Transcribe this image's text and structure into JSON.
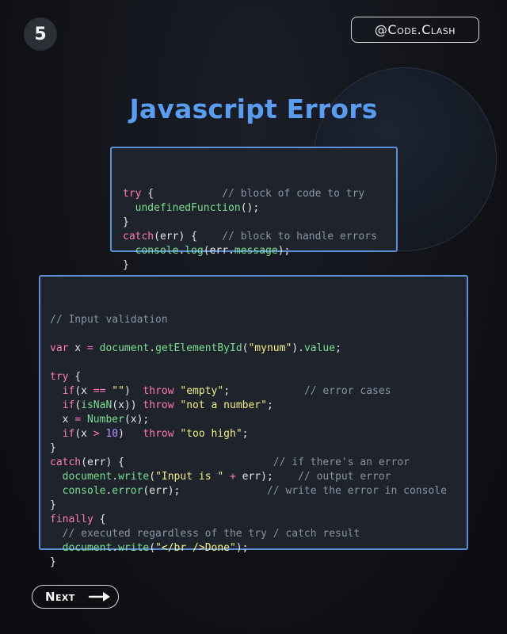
{
  "page_number": "5",
  "handle": "@Code.Clash",
  "title": "Javascript Errors",
  "snippet1": [
    [
      {
        "t": "try",
        "c": "kw"
      },
      {
        "t": " {           ",
        "c": "pl"
      },
      {
        "t": "// block of code to try",
        "c": "cm"
      }
    ],
    [
      {
        "t": "  ",
        "c": "pl"
      },
      {
        "t": "undefinedFunction",
        "c": "fn"
      },
      {
        "t": "();",
        "c": "pl"
      }
    ],
    [
      {
        "t": "}",
        "c": "pl"
      }
    ],
    [
      {
        "t": "catch",
        "c": "kw"
      },
      {
        "t": "(err) {    ",
        "c": "pl"
      },
      {
        "t": "// block to handle errors",
        "c": "cm"
      }
    ],
    [
      {
        "t": "  console",
        "c": "fn"
      },
      {
        "t": ".",
        "c": "pl"
      },
      {
        "t": "log",
        "c": "fn"
      },
      {
        "t": "(err.",
        "c": "pl"
      },
      {
        "t": "message",
        "c": "fn"
      },
      {
        "t": ");",
        "c": "pl"
      }
    ],
    [
      {
        "t": "}",
        "c": "pl"
      }
    ]
  ],
  "snippet2": [
    [
      {
        "t": "// Input validation",
        "c": "cm"
      }
    ],
    [],
    [
      {
        "t": "var",
        "c": "kw"
      },
      {
        "t": " x ",
        "c": "pl"
      },
      {
        "t": "=",
        "c": "op"
      },
      {
        "t": " ",
        "c": "pl"
      },
      {
        "t": "document",
        "c": "fn"
      },
      {
        "t": ".",
        "c": "pl"
      },
      {
        "t": "getElementById",
        "c": "fn"
      },
      {
        "t": "(",
        "c": "pl"
      },
      {
        "t": "\"mynum\"",
        "c": "str"
      },
      {
        "t": ").",
        "c": "pl"
      },
      {
        "t": "value",
        "c": "fn"
      },
      {
        "t": ";",
        "c": "pl"
      }
    ],
    [],
    [
      {
        "t": "try",
        "c": "kw"
      },
      {
        "t": " {",
        "c": "pl"
      }
    ],
    [
      {
        "t": "  ",
        "c": "pl"
      },
      {
        "t": "if",
        "c": "kw"
      },
      {
        "t": "(x ",
        "c": "pl"
      },
      {
        "t": "==",
        "c": "op"
      },
      {
        "t": " ",
        "c": "pl"
      },
      {
        "t": "\"\"",
        "c": "str"
      },
      {
        "t": ")  ",
        "c": "pl"
      },
      {
        "t": "throw",
        "c": "kw"
      },
      {
        "t": " ",
        "c": "pl"
      },
      {
        "t": "\"empty\"",
        "c": "str"
      },
      {
        "t": ";            ",
        "c": "pl"
      },
      {
        "t": "// error cases",
        "c": "cm"
      }
    ],
    [
      {
        "t": "  ",
        "c": "pl"
      },
      {
        "t": "if",
        "c": "kw"
      },
      {
        "t": "(",
        "c": "pl"
      },
      {
        "t": "isNaN",
        "c": "fn"
      },
      {
        "t": "(x)) ",
        "c": "pl"
      },
      {
        "t": "throw",
        "c": "kw"
      },
      {
        "t": " ",
        "c": "pl"
      },
      {
        "t": "\"not a number\"",
        "c": "str"
      },
      {
        "t": ";",
        "c": "pl"
      }
    ],
    [
      {
        "t": "  x ",
        "c": "pl"
      },
      {
        "t": "=",
        "c": "op"
      },
      {
        "t": " ",
        "c": "pl"
      },
      {
        "t": "Number",
        "c": "fn"
      },
      {
        "t": "(x);",
        "c": "pl"
      }
    ],
    [
      {
        "t": "  ",
        "c": "pl"
      },
      {
        "t": "if",
        "c": "kw"
      },
      {
        "t": "(x ",
        "c": "pl"
      },
      {
        "t": ">",
        "c": "op"
      },
      {
        "t": " ",
        "c": "pl"
      },
      {
        "t": "10",
        "c": "num"
      },
      {
        "t": ")   ",
        "c": "pl"
      },
      {
        "t": "throw",
        "c": "kw"
      },
      {
        "t": " ",
        "c": "pl"
      },
      {
        "t": "\"too high\"",
        "c": "str"
      },
      {
        "t": ";",
        "c": "pl"
      }
    ],
    [
      {
        "t": "}",
        "c": "pl"
      }
    ],
    [
      {
        "t": "catch",
        "c": "kw"
      },
      {
        "t": "(err) {                        ",
        "c": "pl"
      },
      {
        "t": "// if there's an error",
        "c": "cm"
      }
    ],
    [
      {
        "t": "  ",
        "c": "pl"
      },
      {
        "t": "document",
        "c": "fn"
      },
      {
        "t": ".",
        "c": "pl"
      },
      {
        "t": "write",
        "c": "fn"
      },
      {
        "t": "(",
        "c": "pl"
      },
      {
        "t": "\"Input is \"",
        "c": "str"
      },
      {
        "t": " ",
        "c": "pl"
      },
      {
        "t": "+",
        "c": "op"
      },
      {
        "t": " err);    ",
        "c": "pl"
      },
      {
        "t": "// output error",
        "c": "cm"
      }
    ],
    [
      {
        "t": "  console",
        "c": "fn"
      },
      {
        "t": ".",
        "c": "pl"
      },
      {
        "t": "error",
        "c": "fn"
      },
      {
        "t": "(err);              ",
        "c": "pl"
      },
      {
        "t": "// write the error in console",
        "c": "cm"
      }
    ],
    [
      {
        "t": "}",
        "c": "pl"
      }
    ],
    [
      {
        "t": "finally",
        "c": "kw"
      },
      {
        "t": " {",
        "c": "pl"
      }
    ],
    [
      {
        "t": "  ",
        "c": "pl"
      },
      {
        "t": "// executed regardless of the try / catch result",
        "c": "cm"
      }
    ],
    [
      {
        "t": "  ",
        "c": "pl"
      },
      {
        "t": "document",
        "c": "fn"
      },
      {
        "t": ".",
        "c": "pl"
      },
      {
        "t": "write",
        "c": "fn"
      },
      {
        "t": "(",
        "c": "pl"
      },
      {
        "t": "\"</br />Done\"",
        "c": "str"
      },
      {
        "t": ");",
        "c": "pl"
      }
    ],
    [
      {
        "t": "}",
        "c": "pl"
      }
    ]
  ],
  "next_label": "Next",
  "icons": {
    "next": "arrow-right-icon"
  },
  "colors": {
    "accent": "#5a9df0",
    "keyword": "#ff7ab8",
    "function": "#7ddf93",
    "string": "#f2ee8a",
    "comment": "#8a93a6",
    "number": "#b794ff"
  }
}
